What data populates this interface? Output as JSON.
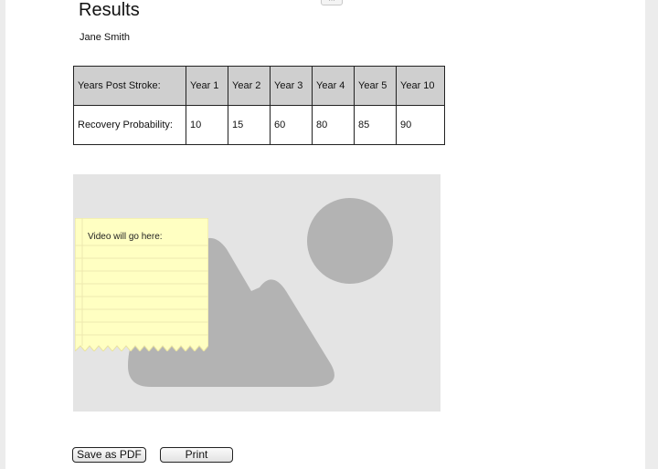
{
  "page": {
    "title": "Results",
    "user_name": "Jane Smith"
  },
  "results_table": {
    "header": [
      "Years Post Stroke:",
      "Year 1",
      "Year 2",
      "Year 3",
      "Year 4",
      "Year 5",
      "Year 10"
    ],
    "row": [
      "Recovery Probability:",
      "10",
      "15",
      "60",
      "80",
      "85",
      "90"
    ]
  },
  "media": {
    "placeholder_icon": "image-placeholder-icon",
    "note_text": "Video will go here:",
    "note_color": "#ffffc2",
    "placeholder_bg": "#e4e4e4",
    "shape_color": "#b3b3b3"
  },
  "buttons": {
    "save_pdf": "Save as PDF",
    "print": "Print"
  }
}
